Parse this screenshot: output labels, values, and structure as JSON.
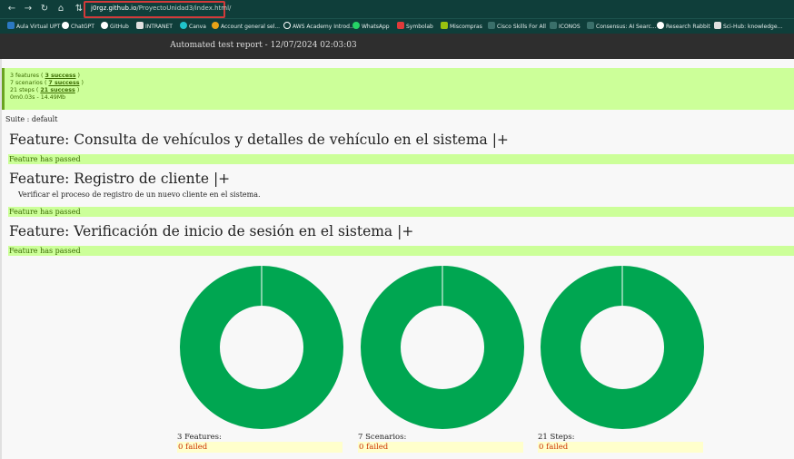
{
  "browser": {
    "url_host": "j0rgz.github.io",
    "url_path": "/ProyectoUnidad3/index.html/",
    "bookmarks": [
      {
        "label": "Aula Virtual UPT",
        "color": "#2b78c2"
      },
      {
        "label": "ChatGPT",
        "color": "#ffffff"
      },
      {
        "label": "GitHub",
        "color": "#ffffff"
      },
      {
        "label": "INTRANET",
        "color": "#e0e0e0"
      },
      {
        "label": "Canva",
        "color": "#20c4cb"
      },
      {
        "label": "Account general sel...",
        "color": "#e8a317"
      },
      {
        "label": "AWS Academy Introd...",
        "color": "#ffffff"
      },
      {
        "label": "WhatsApp",
        "color": "#25d366"
      },
      {
        "label": "Symbolab",
        "color": "#e03a3a"
      },
      {
        "label": "Miscompras",
        "color": "#9ac10f"
      },
      {
        "label": "Cisco Skills For All",
        "color": "#0f3e3a"
      },
      {
        "label": "ICONOS",
        "color": "#0f3e3a"
      },
      {
        "label": "Consensus: AI Searc...",
        "color": "#0f3e3a"
      },
      {
        "label": "Research Rabbit",
        "color": "#ffffff"
      },
      {
        "label": "Sci-Hub: knowledge...",
        "color": "#e0e0e0"
      }
    ]
  },
  "report": {
    "title": "Automated test report - 12/07/2024 02:03:03",
    "summary": {
      "features": {
        "prefix": "3 features ( ",
        "link": "3 success",
        "suffix": " )"
      },
      "scenarios": {
        "prefix": "7 scenarios ( ",
        "link": "7 success",
        "suffix": " )"
      },
      "steps": {
        "prefix": "21 steps ( ",
        "link": "21 success",
        "suffix": " )"
      },
      "timing": "0m0.03s - 14.49Mb"
    },
    "suite": "Suite : default",
    "features": [
      {
        "title": "Feature: Consulta de vehículos y detalles de vehículo en el sistema |+",
        "description": "",
        "status": "Feature has passed"
      },
      {
        "title": "Feature: Registro de cliente |+",
        "description": "Verificar el proceso de registro de un nuevo cliente en el sistema.",
        "status": "Feature has passed"
      },
      {
        "title": "Feature: Verificación de inicio de sesión en el sistema |+",
        "description": "",
        "status": "Feature has passed"
      }
    ],
    "charts": [
      {
        "label": "3 Features:",
        "failed_text": "0 failed",
        "total": 3,
        "passed": 3,
        "failed": 0
      },
      {
        "label": "7 Scenarios:",
        "failed_text": "0 failed",
        "total": 7,
        "passed": 7,
        "failed": 0
      },
      {
        "label": "21 Steps:",
        "failed_text": "0 failed",
        "total": 21,
        "passed": 21,
        "failed": 0
      }
    ],
    "colors": {
      "passed": "#00a651",
      "failed": "#cc3300",
      "summary_bg": "#ccff99",
      "failed_bg": "#ffffcc"
    }
  }
}
